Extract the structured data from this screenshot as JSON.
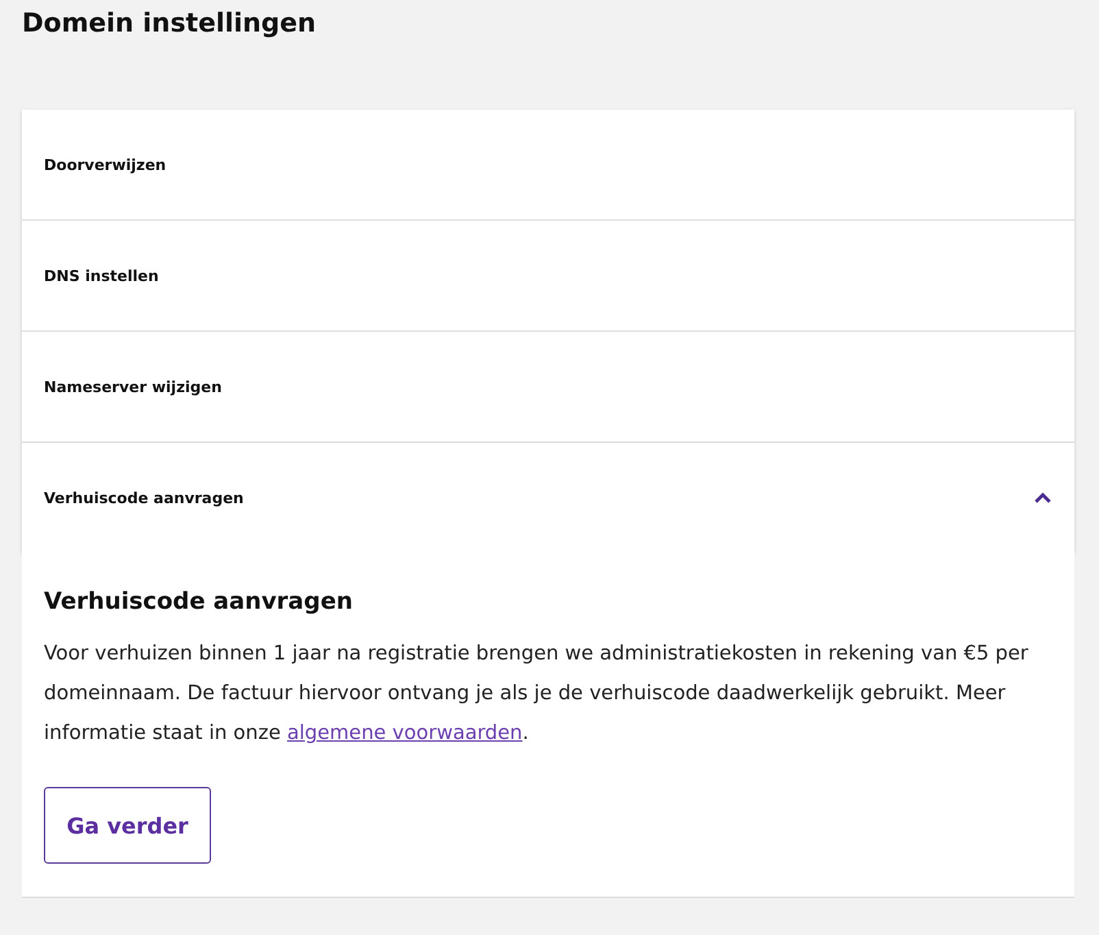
{
  "page": {
    "title": "Domein instellingen"
  },
  "accordion": [
    {
      "label": "Doorverwijzen",
      "expanded": false
    },
    {
      "label": "DNS instellen",
      "expanded": false
    },
    {
      "label": "Nameserver wijzigen",
      "expanded": false
    },
    {
      "label": "Verhuiscode aanvragen",
      "expanded": true
    }
  ],
  "panel": {
    "title": "Verhuiscode aanvragen",
    "text_before": "Voor verhuizen binnen 1 jaar na registratie brengen we administratiekosten in rekening van €5 per domeinnaam. De factuur hiervoor ontvang je als je de verhuiscode daadwerkelijk gebruikt. Meer informatie staat in onze ",
    "link": "algemene voorwaarden",
    "text_after": ".",
    "button": "Ga verder"
  }
}
